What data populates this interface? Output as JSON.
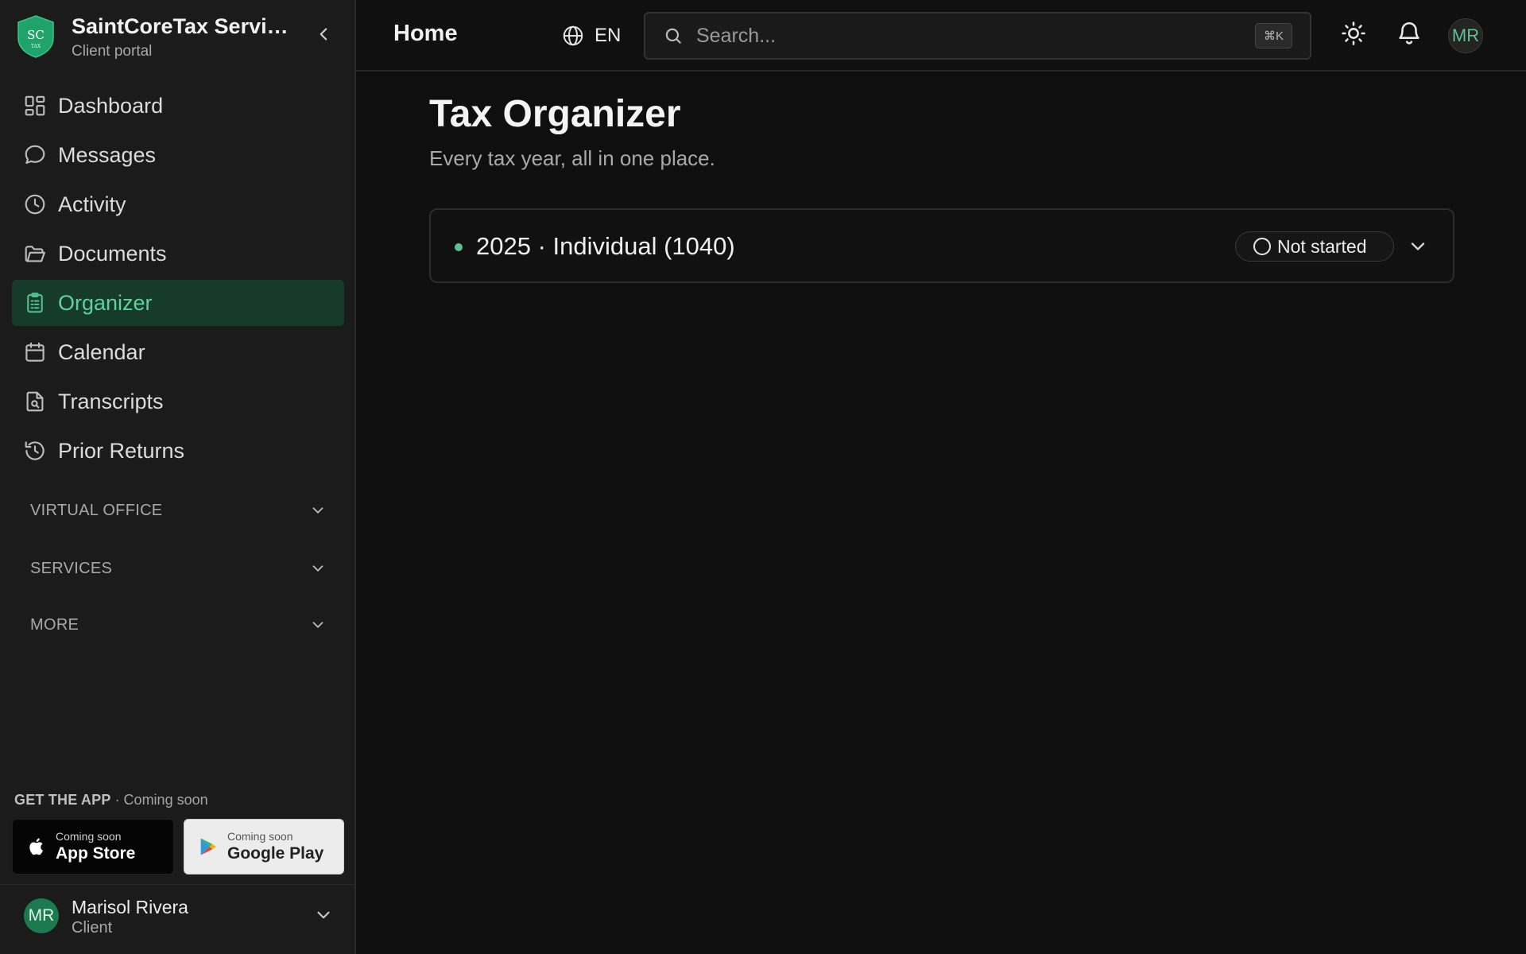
{
  "brand": {
    "name": "SaintCoreTax Services",
    "subtitle": "Client portal",
    "logo_text": "SC",
    "logo_subtext": "TAX",
    "logo_color": "#1fa36b"
  },
  "sidebar": {
    "items": [
      {
        "label": "Dashboard",
        "icon": "dashboard-icon",
        "active": false
      },
      {
        "label": "Messages",
        "icon": "message-icon",
        "active": false
      },
      {
        "label": "Activity",
        "icon": "clock-icon",
        "active": false
      },
      {
        "label": "Documents",
        "icon": "folder-icon",
        "active": false
      },
      {
        "label": "Organizer",
        "icon": "clipboard-icon",
        "active": true
      },
      {
        "label": "Calendar",
        "icon": "calendar-icon",
        "active": false
      },
      {
        "label": "Transcripts",
        "icon": "file-search-icon",
        "active": false
      },
      {
        "label": "Prior Returns",
        "icon": "history-icon",
        "active": false
      }
    ],
    "sections": [
      {
        "label": "VIRTUAL OFFICE"
      },
      {
        "label": "SERVICES"
      },
      {
        "label": "MORE"
      }
    ],
    "get_app": {
      "label": "GET THE APP",
      "note": "· Coming soon",
      "app_store": {
        "small": "Coming soon",
        "big": "App Store"
      },
      "google_play": {
        "small": "Coming soon",
        "big": "Google Play"
      }
    },
    "user": {
      "initials": "MR",
      "name": "Marisol Rivera",
      "role": "Client"
    }
  },
  "header": {
    "title": "Home",
    "language": "EN",
    "search_placeholder": "Search...",
    "search_shortcut": "⌘K",
    "avatar_initials": "MR"
  },
  "main": {
    "title": "Tax Organizer",
    "subtitle": "Every tax year, all in one place.",
    "cards": [
      {
        "title": "2025 · Individual (1040)",
        "status": "Not started"
      }
    ]
  },
  "colors": {
    "accent": "#5fd19b",
    "active_bg": "#173b2b",
    "background": "#0f0f0f",
    "sidebar_bg": "#1b1b1b"
  }
}
